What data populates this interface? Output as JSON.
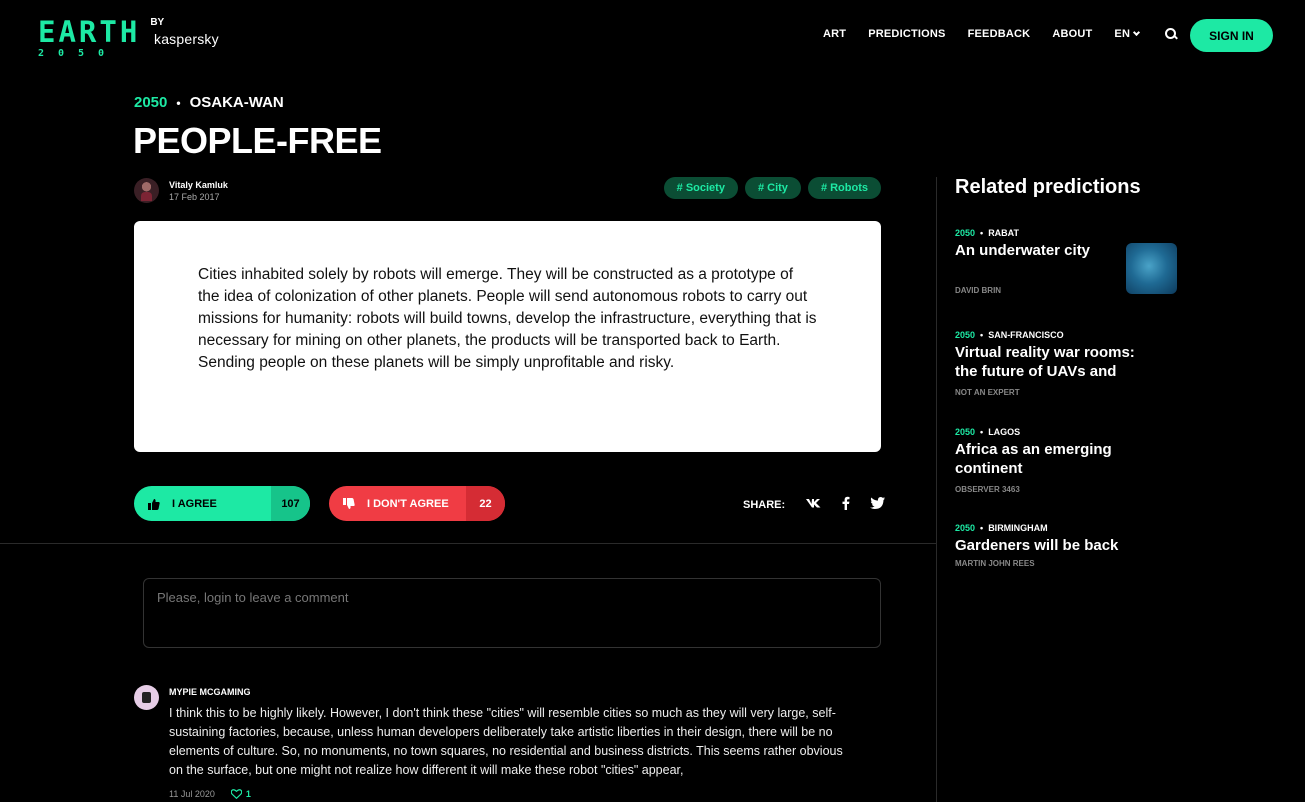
{
  "brand": {
    "logo_main": "EARTH",
    "logo_year": "2050",
    "logo_by": "BY",
    "logo_company": "kaspersky"
  },
  "nav": {
    "items": [
      "ART",
      "PREDICTIONS",
      "FEEDBACK",
      "ABOUT"
    ],
    "lang": "EN",
    "signin": "SIGN IN"
  },
  "article": {
    "year": "2050",
    "place": "OSAKA-WAN",
    "title": "PEOPLE-FREE",
    "author": "Vitaly Kamluk",
    "date": "17 Feb 2017",
    "tags": [
      "# Society",
      "# City",
      "# Robots"
    ],
    "body": "Cities inhabited solely by robots will emerge. They will be constructed as a prototype of the idea of colonization of other planets. People will send autonomous robots to carry out missions for humanity: robots will build towns, develop the infrastructure, everything that is necessary for mining on other planets, the products will be transported back to Earth. Sending people on these planets will be simply unprofitable and risky.",
    "agree_label": "I AGREE",
    "agree_count": "107",
    "disagree_label": "I DON'T AGREE",
    "disagree_count": "22",
    "share_label": "SHARE:",
    "share_icons": {
      "vk": "VK",
      "facebook": "f",
      "twitter": "t"
    }
  },
  "comment_input": {
    "placeholder": "Please, login to leave a comment"
  },
  "comments": [
    {
      "author": "MYPIE MCGAMING",
      "text": "I think this to be highly likely. However, I don't think these \"cities\" will resemble cities so much as they will very large, self-sustaining factories, because, unless human developers deliberately take artistic liberties in their design, there will be no elements of culture. So, no monuments, no town squares, no residential and business districts. This seems rather obvious on the surface, but one might not realize how different it will make these robot \"cities\" appear,",
      "date": "11 Jul 2020",
      "likes": "1"
    }
  ],
  "related": {
    "heading": "Related predictions",
    "items": [
      {
        "year": "2050",
        "place": "RABAT",
        "title": "An underwater city",
        "author": "DAVID BRIN"
      },
      {
        "year": "2050",
        "place": "SAN-FRANCISCO",
        "title": "Virtual reality war rooms: the future of UAVs and",
        "author": "NOT AN EXPERT"
      },
      {
        "year": "2050",
        "place": "LAGOS",
        "title": "Africa as an emerging continent",
        "author": "OBSERVER 3463"
      },
      {
        "year": "2050",
        "place": "BIRMINGHAM",
        "title": "Gardeners will be back",
        "author": "MARTIN JOHN REES"
      }
    ]
  },
  "colors": {
    "accent": "#1de9a4",
    "danger": "#f03c44",
    "background": "#000000"
  }
}
